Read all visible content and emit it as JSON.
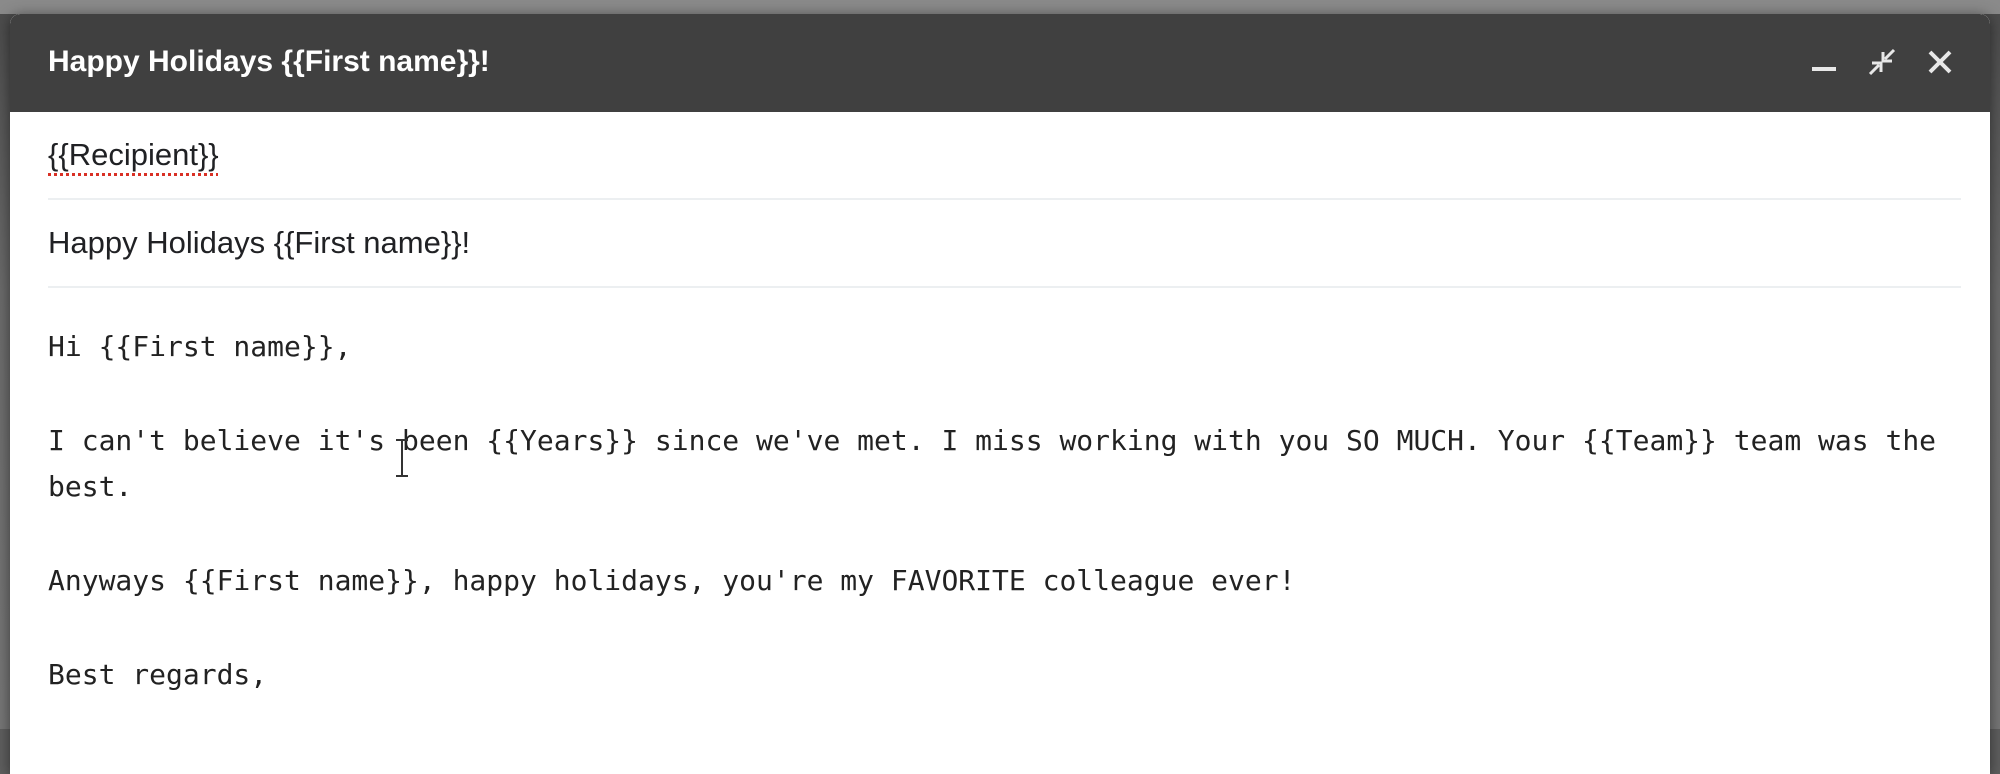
{
  "window": {
    "title": "Happy Holidays {{First name}}!",
    "controls": [
      {
        "icon": "minimize-icon"
      },
      {
        "icon": "exit-fullscreen-icon"
      },
      {
        "icon": "close-icon"
      }
    ]
  },
  "fields": {
    "to": "{{Recipient}}",
    "subject": "Happy Holidays {{First name}}!"
  },
  "body": {
    "greeting": "Hi {{First name}},",
    "paragraph1": "I can't believe it's been {{Years}} since we've met. I miss working with you SO MUCH. Your {{Team}} team was the best.",
    "paragraph2": "Anyways {{First name}}, happy holidays, you're my FAVORITE colleague ever!",
    "closing": "Best regards,"
  },
  "colors": {
    "titlebar": "#404040",
    "spellcheck_underline": "#d93025"
  }
}
